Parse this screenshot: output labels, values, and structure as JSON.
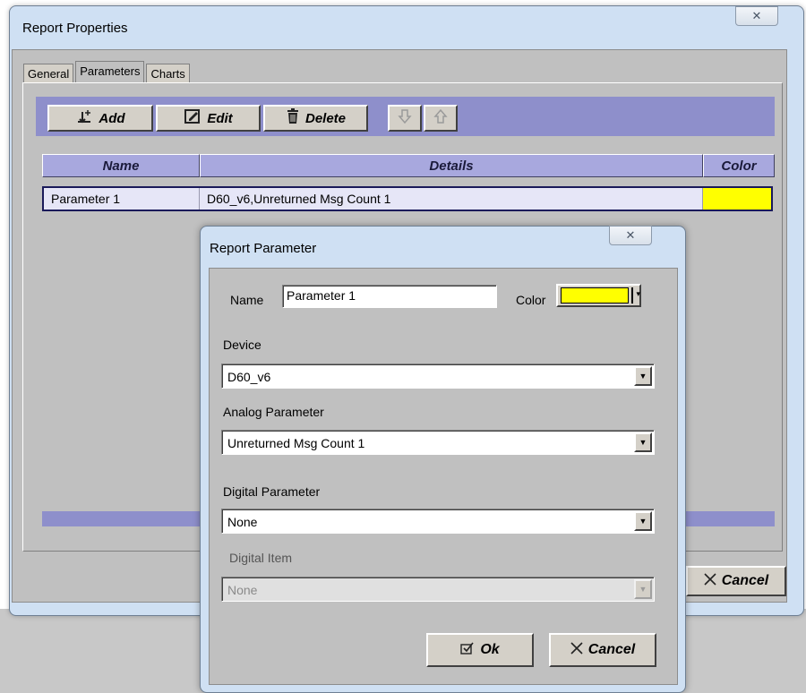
{
  "outer_window": {
    "title": "Report Properties",
    "close_glyph": "✕",
    "tabs": [
      {
        "label": "General",
        "active": false
      },
      {
        "label": "Parameters",
        "active": true
      },
      {
        "label": "Charts",
        "active": false
      }
    ],
    "toolbar": {
      "add_label": "Add",
      "edit_label": "Edit",
      "delete_label": "Delete",
      "add_icon": "add-parameter-icon",
      "edit_icon": "edit-icon",
      "delete_icon": "trash-icon",
      "move_down_icon": "arrow-down-icon",
      "move_up_icon": "arrow-up-icon"
    },
    "grid": {
      "headers": [
        "Name",
        "Details",
        "Color"
      ],
      "rows": [
        {
          "name": "Parameter 1",
          "details": "D60_v6,Unreturned Msg Count 1",
          "color": "#ffff00"
        }
      ]
    },
    "cancel_label": "Cancel"
  },
  "modal": {
    "title": "Report Parameter",
    "close_glyph": "✕",
    "name_label": "Name",
    "name_value": "Parameter 1",
    "color_label": "Color",
    "color_value": "#ffff00",
    "device_label": "Device",
    "device_value": "D60_v6",
    "analog_label": "Analog Parameter",
    "analog_value": "Unreturned Msg Count 1",
    "digital_label": "Digital Parameter",
    "digital_value": "None",
    "digital_item_label": "Digital Item",
    "digital_item_value": "None",
    "ok_label": "Ok",
    "cancel_label": "Cancel"
  },
  "colors": {
    "toolbar_bg": "#8e8fcb",
    "header_bg": "#a8a8de",
    "window_frame": "#cfe0f3",
    "swatch": "#ffff00"
  }
}
